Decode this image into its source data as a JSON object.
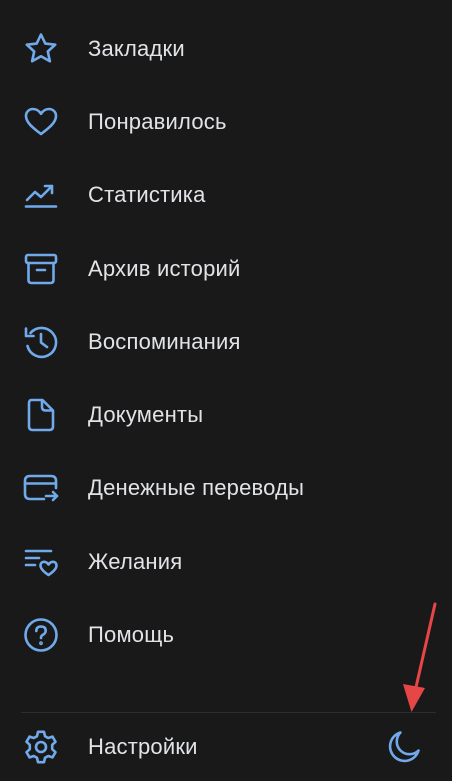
{
  "colors": {
    "background": "#19191a",
    "icon": "#71aaeb",
    "text": "#e1e3e6",
    "divider": "#2c2d2e",
    "annotation_arrow": "#e64646"
  },
  "menu": {
    "items": [
      {
        "label": "Закладки",
        "icon": "star-icon"
      },
      {
        "label": "Понравилось",
        "icon": "heart-icon"
      },
      {
        "label": "Статистика",
        "icon": "trend-chart-icon"
      },
      {
        "label": "Архив историй",
        "icon": "archive-box-icon"
      },
      {
        "label": "Воспоминания",
        "icon": "history-clock-icon"
      },
      {
        "label": "Документы",
        "icon": "document-icon"
      },
      {
        "label": "Денежные переводы",
        "icon": "money-transfer-card-icon"
      },
      {
        "label": "Желания",
        "icon": "wishlist-icon"
      },
      {
        "label": "Помощь",
        "icon": "help-question-icon"
      }
    ]
  },
  "footer": {
    "settings_label": "Настройки",
    "settings_icon": "gear-icon",
    "theme_icon": "moon-icon"
  }
}
